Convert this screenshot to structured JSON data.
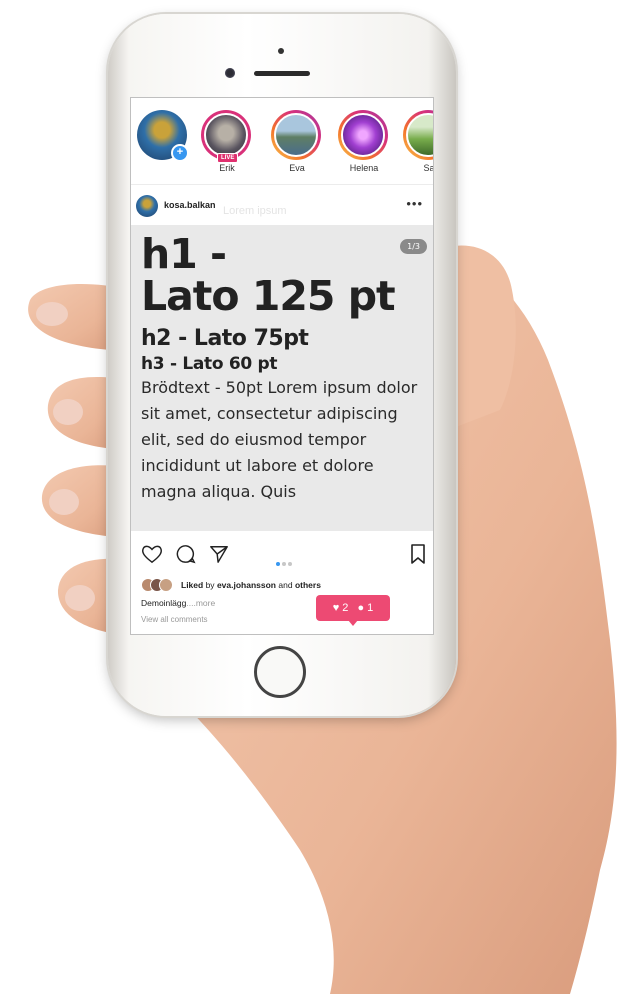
{
  "stories": [
    {
      "name": "",
      "type": "own",
      "color": "#3a7fb5"
    },
    {
      "name": "Erik",
      "type": "live",
      "badge": "LIVE",
      "color": "#6f6a72"
    },
    {
      "name": "Eva",
      "type": "story",
      "color": "#6e9bb7"
    },
    {
      "name": "Helena",
      "type": "story",
      "color": "#8b3db6"
    },
    {
      "name": "Sa",
      "type": "story",
      "color": "#6ea44a"
    }
  ],
  "post": {
    "username": "kosa.balkan",
    "ghost_text": "Lorem ipsum",
    "more_icon": "more-dots-icon",
    "slide_counter": "1/3",
    "h1_line1": "h1 -",
    "h1_line2": "Lato 125 pt",
    "h2": "h2 - Lato 75pt",
    "h3": "h3 - Lato 60 pt",
    "body": "Brödtext - 50pt Lorem ipsum dolor sit amet, consectetur adipiscing elit, sed do eiusmod tempor incididunt ut labore et dolore magna aliqua. Quis"
  },
  "actions": {
    "icons": [
      "heart-icon",
      "comment-icon",
      "send-icon",
      "bookmark-icon"
    ],
    "pager_total": 3,
    "pager_active": 1
  },
  "likes": {
    "prefix": "Liked",
    "by_word": "by",
    "user": "eva.johansson",
    "and_word": "and",
    "others": "others"
  },
  "caption": {
    "text": "Demoinlägg",
    "more": "....more"
  },
  "comments_link": "View all comments",
  "notification": {
    "likes": "2",
    "comments": "1",
    "color": "#ed4a73"
  }
}
